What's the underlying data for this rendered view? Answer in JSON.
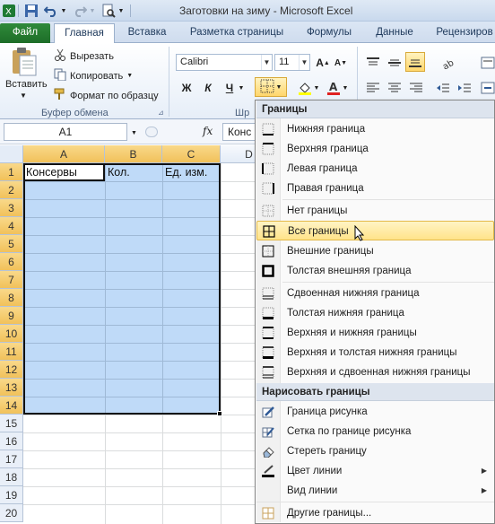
{
  "window": {
    "title": "Заготовки на зиму - Microsoft Excel"
  },
  "tabs": [
    {
      "label": "Файл"
    },
    {
      "label": "Главная"
    },
    {
      "label": "Вставка"
    },
    {
      "label": "Разметка страницы"
    },
    {
      "label": "Формулы"
    },
    {
      "label": "Данные"
    },
    {
      "label": "Рецензиров"
    }
  ],
  "clipboard": {
    "paste": "Вставить",
    "cut": "Вырезать",
    "copy": "Копировать",
    "format_painter": "Формат по образцу",
    "group_label": "Буфер обмена"
  },
  "font": {
    "name": "Calibri",
    "size": "11",
    "bold": "Ж",
    "italic": "К",
    "underline": "Ч",
    "group_label_partial": "Шр"
  },
  "formula_bar": {
    "name_box": "A1",
    "fx": "fx",
    "content": "Конс"
  },
  "columns": [
    "A",
    "B",
    "C",
    "D"
  ],
  "rows": [
    "1",
    "2",
    "3",
    "4",
    "5",
    "6",
    "7",
    "8",
    "9",
    "10",
    "11",
    "12",
    "13",
    "14",
    "15",
    "16",
    "17",
    "18",
    "19",
    "20"
  ],
  "cells": {
    "A1": "Консервы",
    "B1": "Кол.",
    "C1": "Ед. изм."
  },
  "borders_menu": {
    "section_borders": "Границы",
    "items": [
      {
        "label": "Нижняя граница",
        "icon": "bottom-border-icon"
      },
      {
        "label": "Верхняя граница",
        "icon": "top-border-icon"
      },
      {
        "label": "Левая граница",
        "icon": "left-border-icon"
      },
      {
        "label": "Правая граница",
        "icon": "right-border-icon"
      },
      {
        "label": "Нет границы",
        "icon": "no-border-icon"
      },
      {
        "label": "Все границы",
        "icon": "all-borders-icon"
      },
      {
        "label": "Внешние границы",
        "icon": "outside-borders-icon"
      },
      {
        "label": "Толстая внешняя граница",
        "icon": "thick-box-border-icon"
      },
      {
        "label": "Сдвоенная нижняя граница",
        "icon": "double-bottom-border-icon"
      },
      {
        "label": "Толстая нижняя граница",
        "icon": "thick-bottom-border-icon"
      },
      {
        "label": "Верхняя и нижняя границы",
        "icon": "top-bottom-border-icon"
      },
      {
        "label": "Верхняя и толстая нижняя границы",
        "icon": "top-thick-bottom-border-icon"
      },
      {
        "label": "Верхняя и сдвоенная нижняя границы",
        "icon": "top-double-bottom-border-icon"
      }
    ],
    "section_draw": "Нарисовать границы",
    "draw_items": [
      {
        "label": "Граница рисунка",
        "icon": "draw-border-pencil-icon"
      },
      {
        "label": "Сетка по границе рисунка",
        "icon": "draw-border-grid-icon"
      },
      {
        "label": "Стереть границу",
        "icon": "eraser-icon"
      },
      {
        "label": "Цвет линии",
        "icon": "line-color-icon"
      },
      {
        "label": "Вид линии",
        "icon": "line-style-icon"
      }
    ],
    "more": {
      "label": "Другие границы...",
      "icon": "more-borders-icon"
    }
  },
  "colors": {
    "selection": "#bfdaf8",
    "file_tab": "#2a7d34",
    "highlight": "#ffe38a",
    "header_selected": "#f1c15a"
  }
}
